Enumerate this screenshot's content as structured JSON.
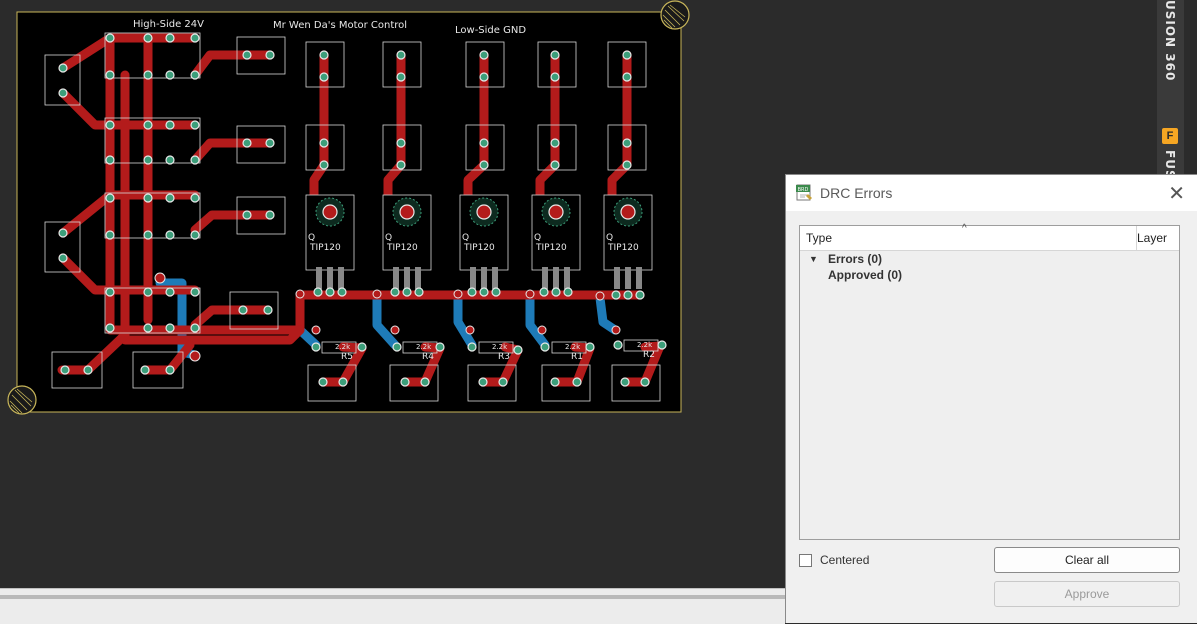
{
  "board": {
    "labels": {
      "high_side": "High-Side 24V",
      "title": "Mr Wen Da's Motor Control",
      "low_side": "Low-Side GND"
    },
    "transistor_part": "TIP120",
    "transistor_prefix": "Q",
    "resistor_value": "2.2k",
    "resistor_names": [
      "R5",
      "R4",
      "R3",
      "R1",
      "R2"
    ],
    "colors": {
      "top_copper": "#b31b1b",
      "bottom_copper": "#1e7bb8",
      "outline": "#c8b65a",
      "pads": "#3c9e7a"
    }
  },
  "side_panel": {
    "label_top": "USION 360",
    "label_bottom": "FUS",
    "logo_letter": "F"
  },
  "drc": {
    "icon_label": "BRD",
    "title": "DRC Errors",
    "columns": {
      "type": "Type",
      "layer": "Layer"
    },
    "tree": [
      {
        "label": "Errors (0)",
        "expanded": true
      },
      {
        "label": "Approved (0)"
      }
    ],
    "centered_label": "Centered",
    "centered_checked": false,
    "clear_all_label": "Clear all",
    "approve_label": "Approve",
    "approve_enabled": false
  }
}
